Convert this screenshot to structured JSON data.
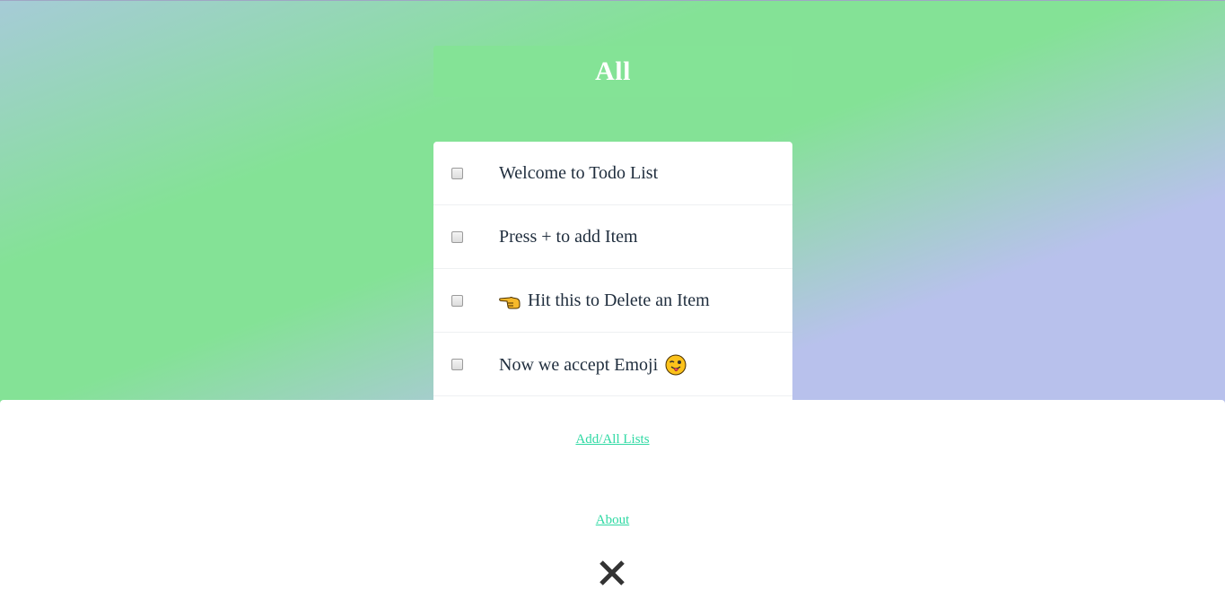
{
  "header": {
    "title": "All"
  },
  "todos": [
    {
      "text": "Welcome to Todo List",
      "checked": false
    },
    {
      "text": "Press + to add Item",
      "checked": false
    },
    {
      "text": "Hit this to Delete an Item",
      "checked": false,
      "icon": "backhand-pointing-left-icon"
    },
    {
      "text": "Now we accept Emoji",
      "checked": false,
      "icon": "winking-tongue-face-icon"
    }
  ],
  "menu": {
    "add_all_lists_label": "Add/All Lists",
    "about_label": "About",
    "close_icon": "close-icon"
  },
  "colors": {
    "header_bg": "#84e396",
    "link": "#2ed9a3",
    "background_green": "#84e296",
    "background_lavender": "#b8c1ec"
  }
}
